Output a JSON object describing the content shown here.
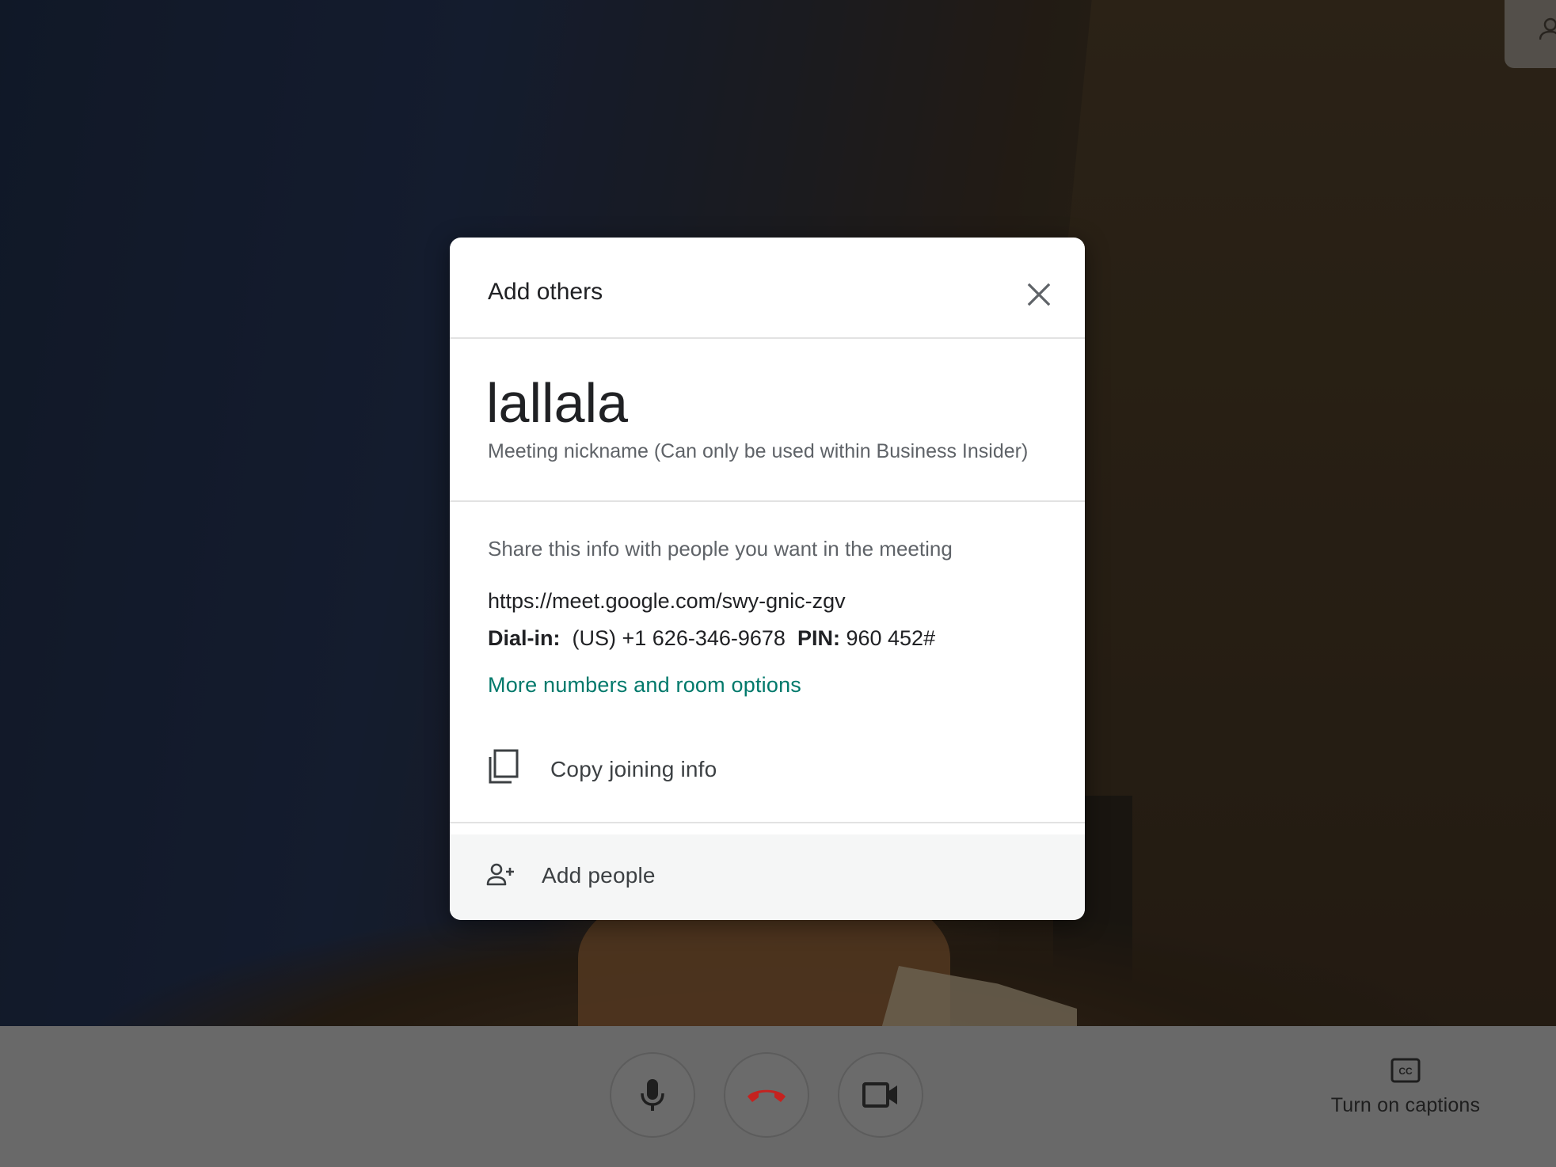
{
  "dialog": {
    "title": "Add others",
    "close_icon": "close-icon",
    "meeting_nickname": "lallala",
    "nickname_caption": "Meeting nickname (Can only be used within Business Insider)",
    "share_intro": "Share this info with people you want in the meeting",
    "meeting_url": "https://meet.google.com/swy-gnic-zgv",
    "dial_in_label": "Dial-in:",
    "dial_in_number": "(US) +1 626-346-9678",
    "pin_label": "PIN:",
    "pin_value": "960 452#",
    "more_numbers_link": "More numbers and room options",
    "copy_label": "Copy joining info",
    "copy_icon": "copy-icon",
    "add_people_label": "Add people",
    "add_people_icon": "person-add-icon"
  },
  "controls": {
    "mic_icon": "microphone-icon",
    "hangup_icon": "hang-up-icon",
    "camera_icon": "camera-icon",
    "captions_icon": "closed-captions-icon",
    "captions_label": "Turn on captions"
  },
  "colors": {
    "link": "#00796b",
    "hangup": "#c5221f",
    "control_bar": "#696969"
  }
}
